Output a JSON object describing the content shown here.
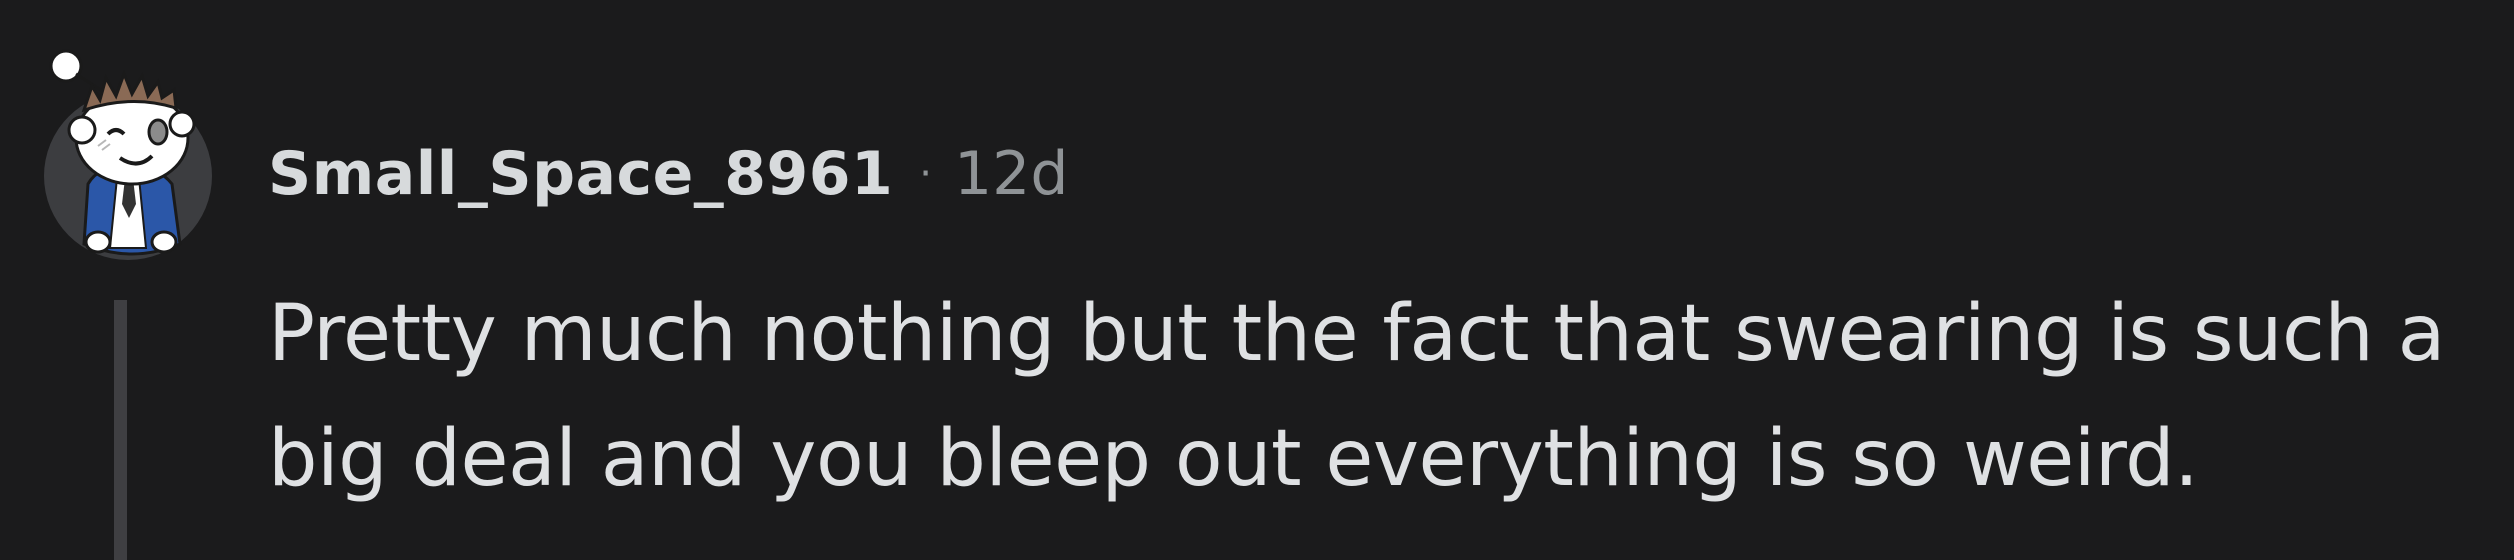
{
  "comment": {
    "author": "Small_Space_8961",
    "separator": "·",
    "age": "12d",
    "body": "Pretty much nothing but the fact that swearing is such a big deal and you bleep out everything is so weird."
  },
  "icons": {
    "avatar": "snoo-avatar-icon"
  },
  "colors": {
    "background": "#1b1b1c",
    "username": "#d7dadc",
    "meta": "#8f9396",
    "body_text": "#dfe1e3",
    "thread_line": "#3f3f42",
    "avatar_jacket": "#2b57a8"
  }
}
